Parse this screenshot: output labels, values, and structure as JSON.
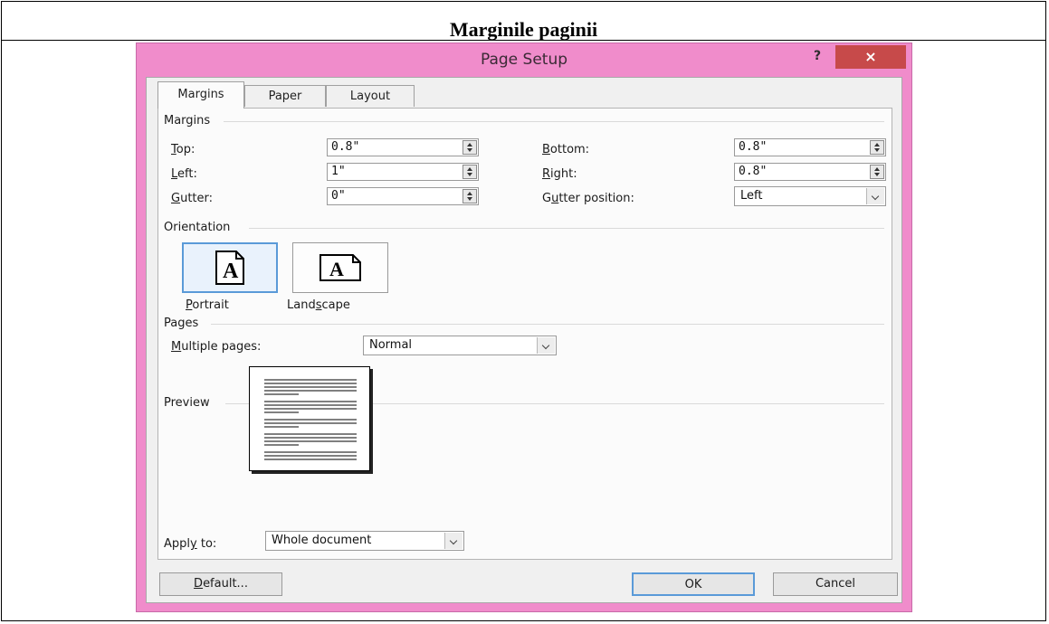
{
  "document": {
    "header_title": "Marginile paginii"
  },
  "dialog": {
    "title": "Page Setup",
    "help": "?",
    "close": "×",
    "tabs": [
      {
        "label": "Margins",
        "active": true
      },
      {
        "label": "Paper",
        "active": false
      },
      {
        "label": "Layout",
        "active": false
      }
    ],
    "margins": {
      "section_label": "Margins",
      "top_label": "Top:",
      "top_value": "0.8\"",
      "bottom_label": "Bottom:",
      "bottom_value": "0.8\"",
      "left_label": "Left:",
      "left_value": "1\"",
      "right_label": "Right:",
      "right_value": "0.8\"",
      "gutter_label": "Gutter:",
      "gutter_value": "0\"",
      "gutter_position_label": "Gutter position:",
      "gutter_position_value": "Left"
    },
    "orientation": {
      "section_label": "Orientation",
      "portrait_label": "Portrait",
      "landscape_label": "Landscape",
      "selected": "portrait"
    },
    "pages": {
      "section_label": "Pages",
      "multiple_pages_label": "Multiple pages:",
      "multiple_pages_value": "Normal"
    },
    "preview": {
      "section_label": "Preview"
    },
    "apply_to": {
      "label": "Apply to:",
      "value": "Whole document"
    },
    "buttons": {
      "default": "Default...",
      "ok": "OK",
      "cancel": "Cancel"
    },
    "colors": {
      "title_bar": "#f08ccb",
      "close_button": "#c74a4a",
      "client": "#f0f0f0",
      "selected_border": "#5a9ad8"
    },
    "icons": [
      "help-icon",
      "close-icon",
      "spin-up-down-icon",
      "chevron-down-icon",
      "portrait-page-icon",
      "landscape-page-icon"
    ]
  }
}
